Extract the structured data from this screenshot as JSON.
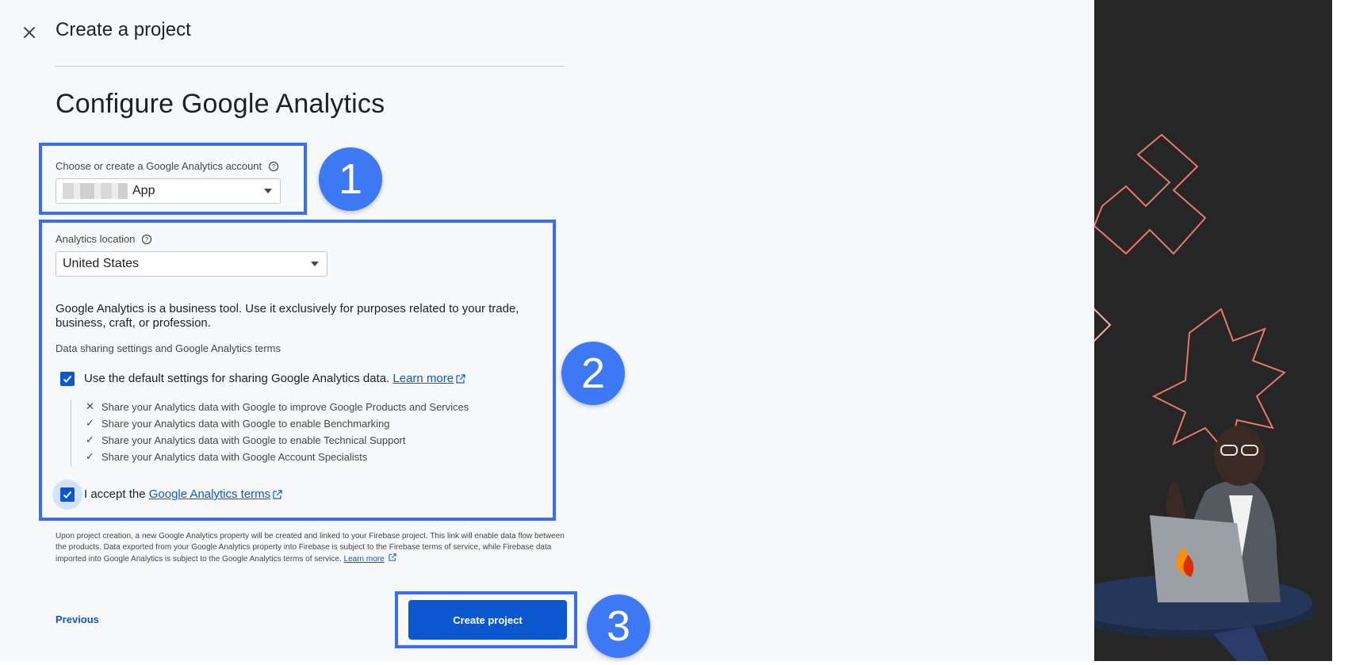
{
  "header": {
    "title": "Create a project",
    "close_icon": "close-icon"
  },
  "page": {
    "title": "Configure Google Analytics"
  },
  "account": {
    "label": "Choose or create a Google Analytics account",
    "value": "App"
  },
  "location": {
    "label": "Analytics location",
    "value": "United States"
  },
  "business_notice": "Google Analytics is a business tool. Use it exclusively for purposes related to your trade, business, craft, or profession.",
  "sharing": {
    "heading": "Data sharing settings and Google Analytics terms",
    "default_label": "Use the default settings for sharing Google Analytics data.",
    "learn_more": "Learn more",
    "items": [
      {
        "mark": "✕",
        "text": "Share your Analytics data with Google to improve Google Products and Services"
      },
      {
        "mark": "✓",
        "text": "Share your Analytics data with Google to enable Benchmarking"
      },
      {
        "mark": "✓",
        "text": "Share your Analytics data with Google to enable Technical Support"
      },
      {
        "mark": "✓",
        "text": "Share your Analytics data with Google Account Specialists"
      }
    ],
    "accept_prefix": "I accept the",
    "accept_link": "Google Analytics terms"
  },
  "footnote": {
    "text": "Upon project creation, a new Google Analytics property will be created and linked to your Firebase project. This link will enable data flow between the products. Data exported from your Google Analytics property into Firebase is subject to the Firebase terms of service, while Firebase data imported into Google Analytics is subject to the Google Analytics terms of service.",
    "link": "Learn more"
  },
  "actions": {
    "previous": "Previous",
    "create": "Create project"
  },
  "steps": [
    "1",
    "2",
    "3"
  ],
  "colors": {
    "primary": "#0b57d0",
    "highlight": "#3b6cf4",
    "badge": "#3d78f5",
    "panel": "#262626"
  }
}
